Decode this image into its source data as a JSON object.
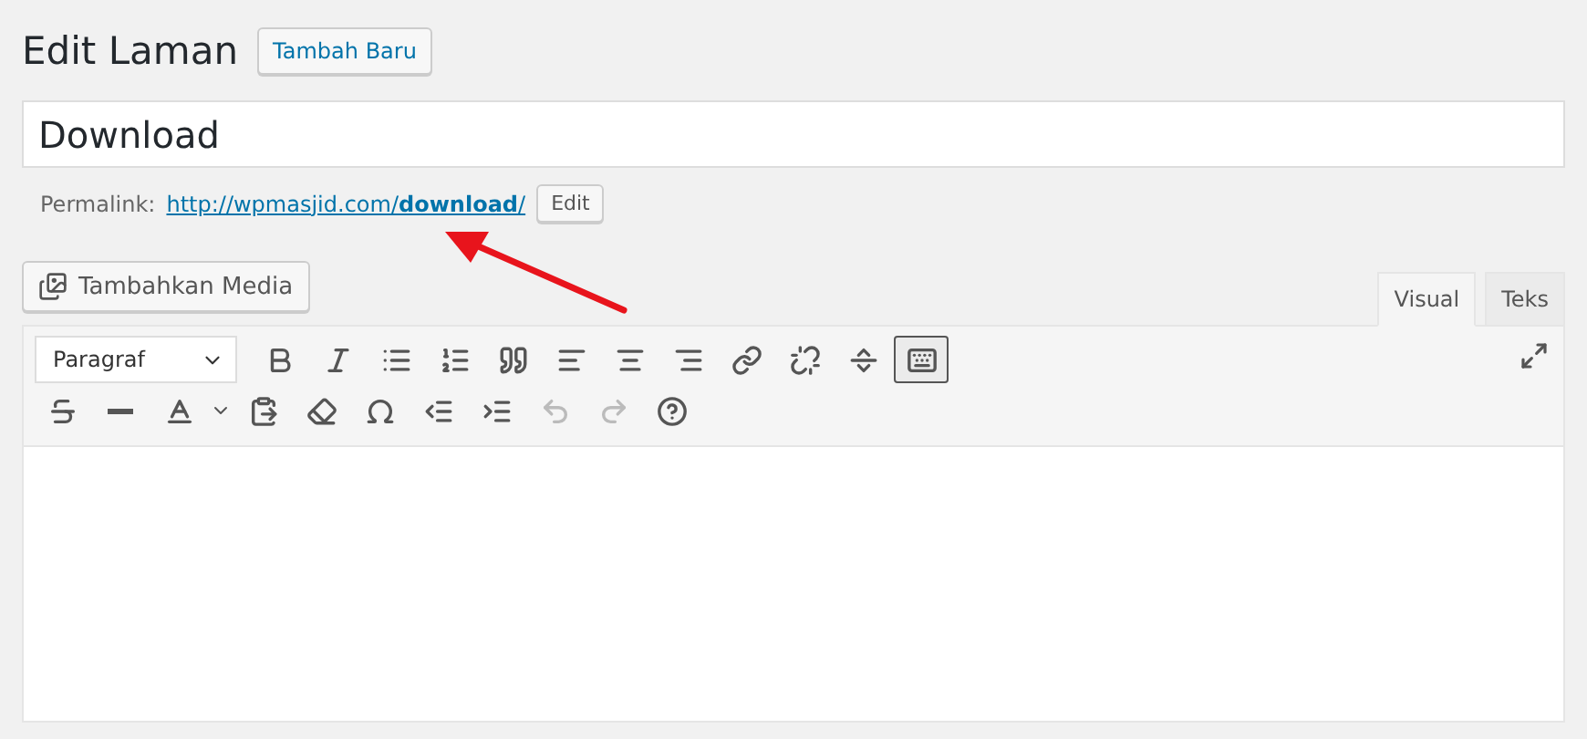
{
  "page": {
    "title": "Edit Laman",
    "add_new_button": "Tambah Baru"
  },
  "post_title": {
    "value": "Download"
  },
  "permalink": {
    "label": "Permalink:",
    "url": "http://wpmasjid.com/**download**/",
    "edit_button": "Edit"
  },
  "add_media_button": "Tambahkan Media",
  "editor_tabs": [
    {
      "label": "Visual",
      "selected": true
    },
    {
      "label": "Teks",
      "selected": false
    }
  ],
  "toolbar_row_1": [
    {
      "kind": "dropdown",
      "value": "Paragraf"
    },
    {
      "kind": "button",
      "on": false,
      "disabled": false
    },
    {
      "kind": "button",
      "on": false,
      "disabled": false
    },
    {
      "kind": "button",
      "on": false,
      "disabled": false
    },
    {
      "kind": "button",
      "on": false,
      "disabled": false
    },
    {
      "kind": "button",
      "on": false,
      "disabled": false
    },
    {
      "kind": "button",
      "on": false,
      "disabled": false
    },
    {
      "kind": "button",
      "on": false,
      "disabled": false
    },
    {
      "kind": "button",
      "on": false,
      "disabled": false
    },
    {
      "kind": "button",
      "on": false,
      "disabled": false
    },
    {
      "kind": "button",
      "on": false,
      "disabled": false
    },
    {
      "kind": "button",
      "on": false,
      "disabled": false
    },
    {
      "kind": "button",
      "on": true,
      "disabled": false
    }
  ],
  "toolbar_row_2": [
    {
      "kind": "button",
      "on": false,
      "disabled": false
    },
    {
      "kind": "button",
      "on": false,
      "disabled": false
    },
    {
      "kind": "color",
      "on": false,
      "disabled": false
    },
    {
      "kind": "button",
      "on": false,
      "disabled": false
    },
    {
      "kind": "button",
      "on": false,
      "disabled": false
    },
    {
      "kind": "button",
      "on": false,
      "disabled": false
    },
    {
      "kind": "button",
      "on": false,
      "disabled": false
    },
    {
      "kind": "button",
      "on": false,
      "disabled": false
    },
    {
      "kind": "button",
      "on": false,
      "disabled": true
    },
    {
      "kind": "button",
      "on": false,
      "disabled": true
    },
    {
      "kind": "button",
      "on": false,
      "disabled": false
    }
  ]
}
